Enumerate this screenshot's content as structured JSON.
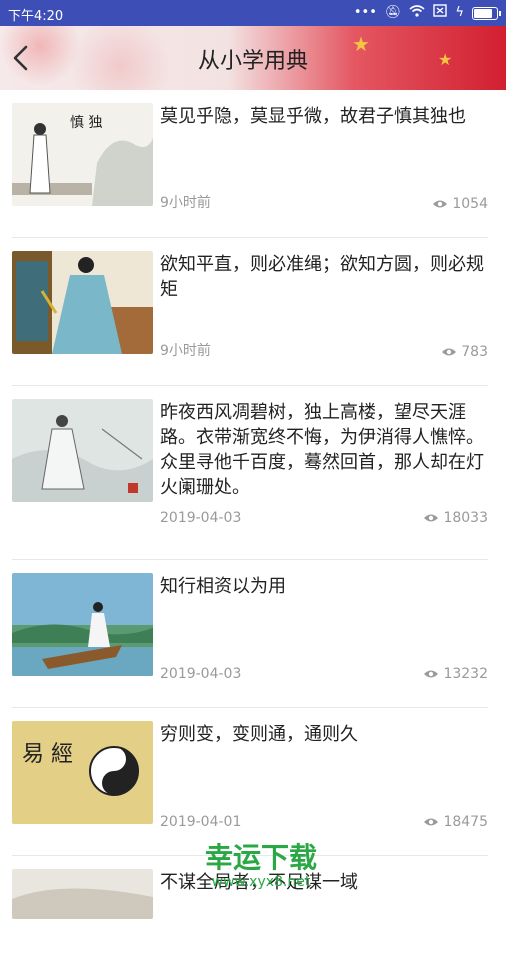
{
  "status": {
    "time": "下午4:20",
    "icons": [
      "signal-icon",
      "mute-icon",
      "wifi-icon",
      "sim-icon",
      "charging-icon",
      "battery-icon"
    ]
  },
  "header": {
    "title": "从小学用典",
    "back_icon": "back-arrow-icon"
  },
  "items": [
    {
      "text": "莫见乎隐，莫显乎微，故君子慎其独也",
      "date": "9小时前",
      "views": "1054",
      "thumb_text": "慎 独"
    },
    {
      "text": "欲知平直，则必准绳；欲知方圆，则必规矩",
      "date": "9小时前",
      "views": "783"
    },
    {
      "text": "昨夜西风凋碧树，独上高楼，望尽天涯路。衣带渐宽终不悔，为伊消得人憔悴。众里寻他千百度，蓦然回首，那人却在灯火阑珊处。",
      "date": "2019-04-03",
      "views": "18033"
    },
    {
      "text": "知行相资以为用",
      "date": "2019-04-03",
      "views": "13232"
    },
    {
      "text": "穷则变，变则通，通则久",
      "date": "2019-04-01",
      "views": "18475",
      "thumb_text": "易 經"
    },
    {
      "text": "不谋全局者，不足谋一域",
      "date": "",
      "views": ""
    }
  ],
  "watermark": {
    "title": "幸运下载",
    "url": "www.xyx8.net"
  }
}
